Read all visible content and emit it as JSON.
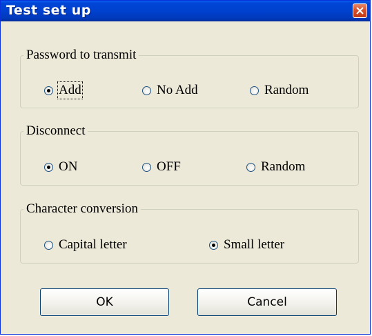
{
  "window": {
    "title": "Test set up",
    "close_icon": "close-icon"
  },
  "groups": {
    "password": {
      "legend": "Password to transmit",
      "options": [
        {
          "label": "Add",
          "checked": true
        },
        {
          "label": "No Add",
          "checked": false
        },
        {
          "label": "Random",
          "checked": false
        }
      ]
    },
    "disconnect": {
      "legend": "Disconnect",
      "options": [
        {
          "label": "ON",
          "checked": true
        },
        {
          "label": "OFF",
          "checked": false
        },
        {
          "label": "Random",
          "checked": false
        }
      ]
    },
    "conversion": {
      "legend": "Character conversion",
      "options": [
        {
          "label": "Capital letter",
          "checked": false
        },
        {
          "label": "Small letter",
          "checked": true
        }
      ]
    }
  },
  "buttons": {
    "ok": "OK",
    "cancel": "Cancel"
  },
  "colors": {
    "titlebar": "#0041cf",
    "dialog_bg": "#ece9d8",
    "close": "#d5502c"
  }
}
